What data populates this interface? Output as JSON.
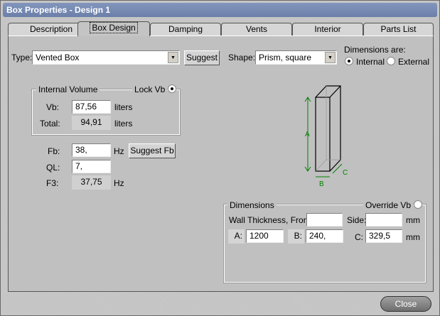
{
  "window": {
    "title": "Box Properties - Design 1"
  },
  "tabs": [
    "Description",
    "Box Design",
    "Damping",
    "Vents",
    "Interior",
    "Parts List"
  ],
  "type": {
    "label": "Type:",
    "value": "Vented Box",
    "suggest": "Suggest"
  },
  "shape": {
    "label": "Shape:",
    "value": "Prism, square"
  },
  "dimensions_are": {
    "label": "Dimensions are:",
    "internal": "Internal",
    "external": "External",
    "selected": "Internal"
  },
  "internal_volume": {
    "title": "Internal Volume",
    "lock_label": "Lock Vb",
    "lock_checked": true,
    "vb_label": "Vb:",
    "vb_value": "87,56",
    "vb_unit": "liters",
    "total_label": "Total:",
    "total_value": "94,91",
    "total_unit": "liters"
  },
  "tuning": {
    "fb_label": "Fb:",
    "fb_value": "38,",
    "fb_unit": "Hz",
    "suggest_fb": "Suggest Fb",
    "ql_label": "QL:",
    "ql_value": "7,",
    "f3_label": "F3:",
    "f3_value": "37,75",
    "f3_unit": "Hz"
  },
  "diagram": {
    "a": "A",
    "b": "B",
    "c": "C",
    "color": "#008000"
  },
  "dimensions": {
    "title": "Dimensions",
    "override_label": "Override Vb",
    "override_checked": false,
    "wall_label": "Wall Thickness, Front:",
    "wall_front": "",
    "side_label": "Side:",
    "side_value": "",
    "unit": "mm",
    "a_label": "A:",
    "a_value": "1200",
    "b_label": "B:",
    "b_value": "240,",
    "c_label": "C:",
    "c_value": "329,5"
  },
  "close": "Close"
}
